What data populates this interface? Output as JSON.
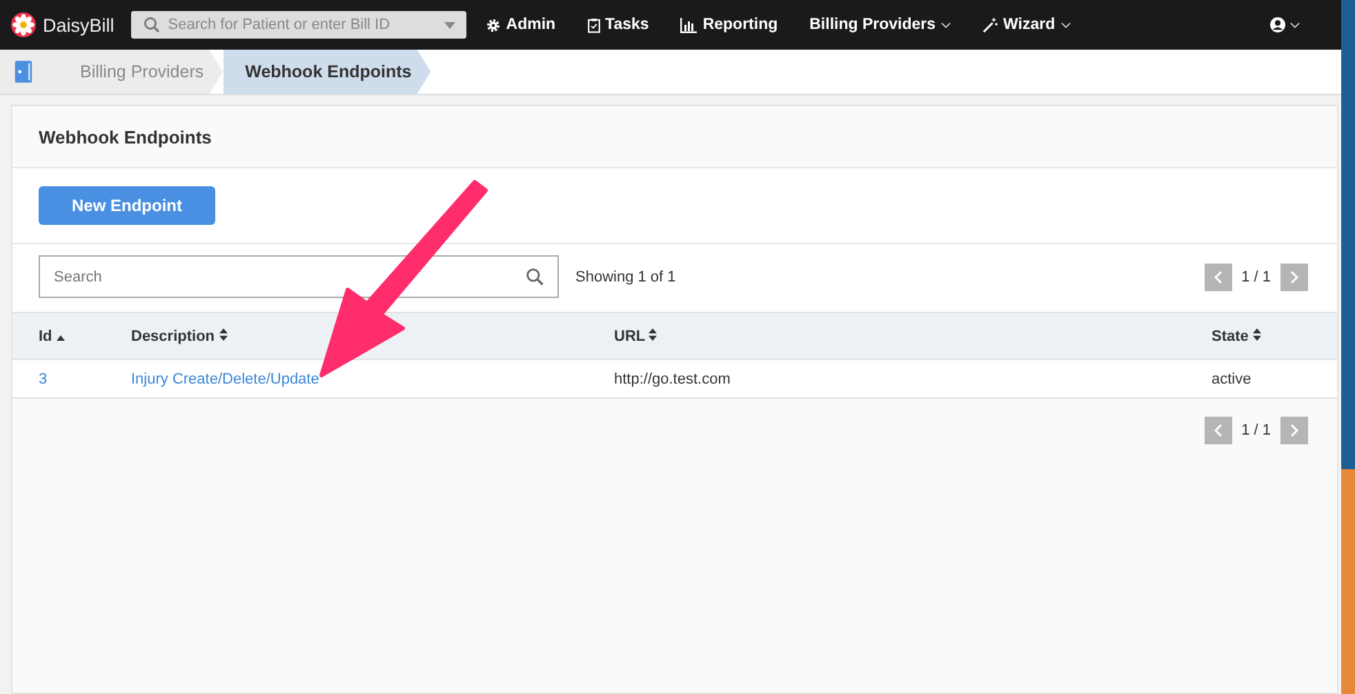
{
  "navbar": {
    "brand": "DaisyBill",
    "search": {
      "placeholder": "Search for Patient or enter Bill ID"
    },
    "items": [
      {
        "label": "Admin",
        "dropdown": false
      },
      {
        "label": "Tasks",
        "dropdown": false
      },
      {
        "label": "Reporting",
        "dropdown": false
      },
      {
        "label": "Billing Providers",
        "dropdown": true
      },
      {
        "label": "Wizard",
        "dropdown": true
      }
    ]
  },
  "breadcrumbs": [
    {
      "label": "Billing Providers",
      "selected": false
    },
    {
      "label": "Webhook Endpoints",
      "selected": true
    }
  ],
  "card": {
    "title": "Webhook Endpoints",
    "new_button": "New Endpoint",
    "search": {
      "placeholder": "Search"
    },
    "showing": "Showing 1 of 1",
    "pager_top": "1 / 1",
    "pager_bottom": "1 / 1",
    "columns": [
      {
        "label": "Id"
      },
      {
        "label": "Description"
      },
      {
        "label": "URL"
      },
      {
        "label": "State"
      }
    ],
    "rows": [
      {
        "id": "3",
        "description": "Injury Create/Delete/Update",
        "url": "http://go.test.com",
        "state": "active"
      }
    ]
  }
}
